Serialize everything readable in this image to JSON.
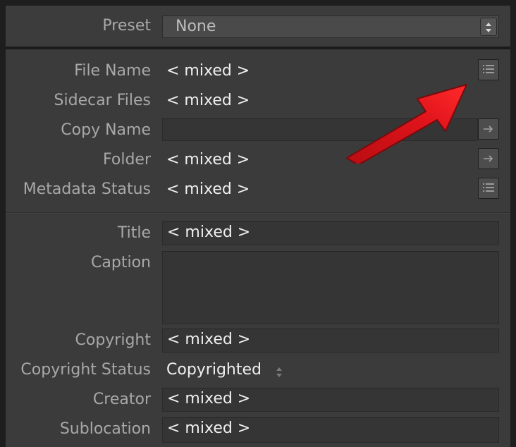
{
  "preset": {
    "label": "Preset",
    "value": "None"
  },
  "file_info": {
    "file_name": {
      "label": "File Name",
      "value": "< mixed >"
    },
    "sidecar_files": {
      "label": "Sidecar Files",
      "value": "< mixed >"
    },
    "copy_name": {
      "label": "Copy Name",
      "value": ""
    },
    "folder": {
      "label": "Folder",
      "value": "< mixed >"
    },
    "metadata_status": {
      "label": "Metadata Status",
      "value": "< mixed >"
    }
  },
  "iptc": {
    "title": {
      "label": "Title",
      "value": "< mixed >"
    },
    "caption": {
      "label": "Caption",
      "value": ""
    },
    "copyright": {
      "label": "Copyright",
      "value": "< mixed >"
    },
    "copyright_status": {
      "label": "Copyright Status",
      "value": "Copyrighted"
    },
    "creator": {
      "label": "Creator",
      "value": "< mixed >"
    },
    "sublocation": {
      "label": "Sublocation",
      "value": "< mixed >"
    }
  },
  "icons": {
    "list": "list-icon",
    "go_arrow": "right-arrow-icon",
    "stepper": "up-down-stepper-icon",
    "annotation": "red-arrow-annotation"
  },
  "colors": {
    "annotation_red": "#e0141b"
  }
}
